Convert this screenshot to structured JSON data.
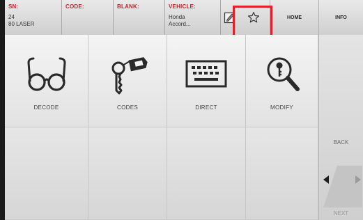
{
  "header": {
    "sn": {
      "label": "SN:",
      "value_line1": "24",
      "value_line2": "80 LASER"
    },
    "code": {
      "label": "CODE:"
    },
    "blank": {
      "label": "BLANK:"
    },
    "vehicle": {
      "label": "VEHICLE:",
      "value_line1": "Honda",
      "value_line2": "Accord..."
    },
    "home_label": "HOME",
    "info_label": "INFO"
  },
  "tiles": [
    {
      "label": "DECODE",
      "icon": "glasses-icon"
    },
    {
      "label": "CODES",
      "icon": "key-tag-icon"
    },
    {
      "label": "DIRECT",
      "icon": "keyboard-icon"
    },
    {
      "label": "MODIFY",
      "icon": "magnifier-key-icon"
    }
  ],
  "sidebar": {
    "back_label": "BACK",
    "next_label": "NEXT"
  },
  "colors": {
    "label_red": "#c0282d",
    "highlight": "#e0202a"
  }
}
